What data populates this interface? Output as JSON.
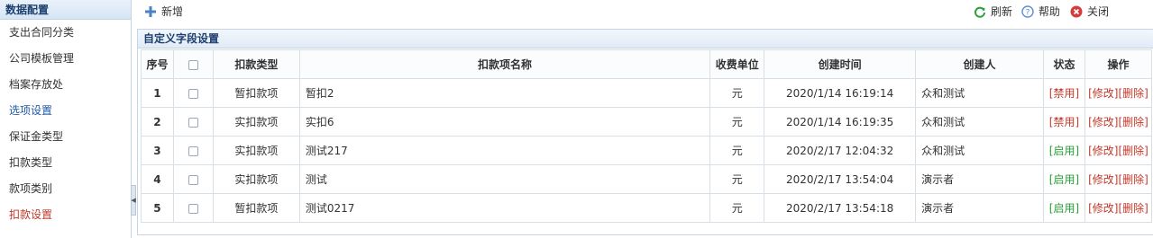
{
  "sidebar": {
    "title": "数据配置",
    "items": [
      {
        "label": "支出合同分类"
      },
      {
        "label": "公司模板管理"
      },
      {
        "label": "档案存放处"
      },
      {
        "label": "选项设置"
      },
      {
        "label": "保证金类型"
      },
      {
        "label": "扣款类型"
      },
      {
        "label": "款项类别"
      },
      {
        "label": "扣款设置"
      }
    ]
  },
  "toolbar": {
    "add_label": "新增",
    "refresh_label": "刷新",
    "help_label": "帮助",
    "close_label": "关闭"
  },
  "panel": {
    "title": "自定义字段设置"
  },
  "table": {
    "headers": [
      "序号",
      "",
      "扣款类型",
      "扣款项名称",
      "收费单位",
      "创建时间",
      "创建人",
      "状态",
      "操作"
    ],
    "rows": [
      {
        "no": "1",
        "type": "暂扣款项",
        "name": "暂扣2",
        "unit": "元",
        "created": "2020/1/14 16:19:14",
        "creator": "众和测试",
        "status": "[禁用]",
        "edit": "[修改]",
        "del": "[删除]"
      },
      {
        "no": "2",
        "type": "实扣款项",
        "name": "实扣6",
        "unit": "元",
        "created": "2020/1/14 16:19:35",
        "creator": "众和测试",
        "status": "[禁用]",
        "edit": "[修改]",
        "del": "[删除]"
      },
      {
        "no": "3",
        "type": "实扣款项",
        "name": "测试217",
        "unit": "元",
        "created": "2020/2/17 12:04:32",
        "creator": "众和测试",
        "status": "[启用]",
        "edit": "[修改]",
        "del": "[删除]"
      },
      {
        "no": "4",
        "type": "实扣款项",
        "name": "测试",
        "unit": "元",
        "created": "2020/2/17 13:54:04",
        "creator": "演示者",
        "status": "[启用]",
        "edit": "[修改]",
        "del": "[删除]"
      },
      {
        "no": "5",
        "type": "暂扣款项",
        "name": "测试0217",
        "unit": "元",
        "created": "2020/2/17 13:54:18",
        "creator": "演示者",
        "status": "[启用]",
        "edit": "[修改]",
        "del": "[删除]"
      }
    ]
  },
  "colors": {
    "accent": "#1d5aa8",
    "disabled_status": "#c0392b",
    "enabled_status": "#27a035",
    "border": "#c5d5e6"
  }
}
